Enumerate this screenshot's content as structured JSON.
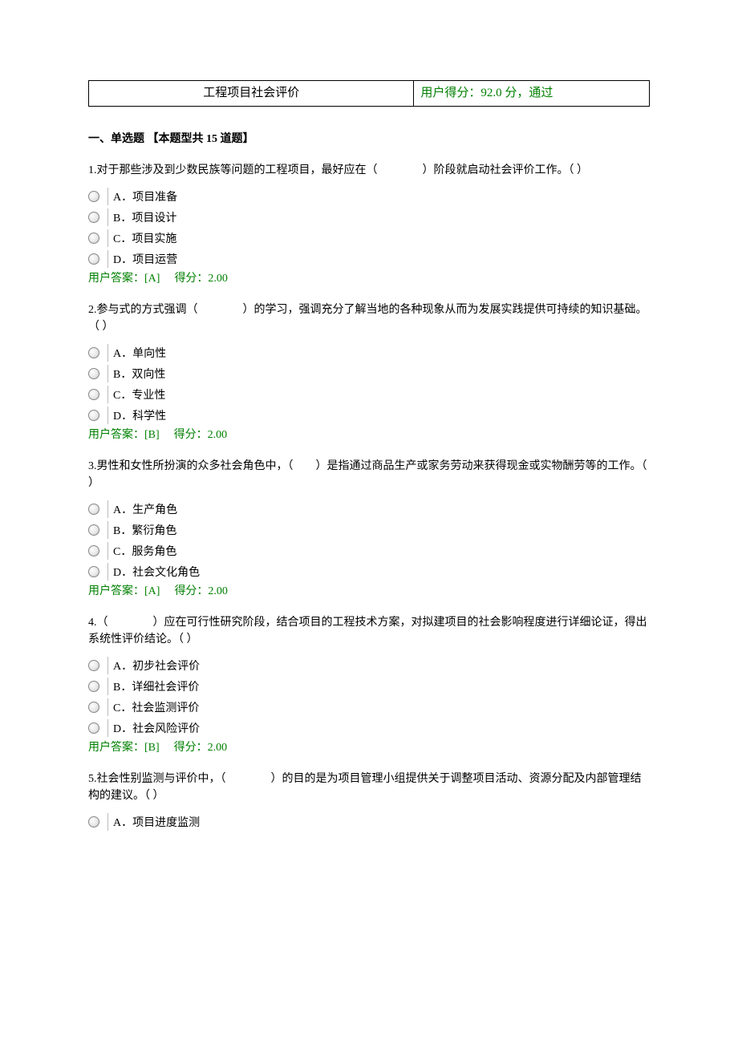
{
  "header": {
    "title": "工程项目社会评价",
    "score": "用户得分：92.0 分，通过"
  },
  "section": {
    "title": "一、单选题 【本题型共 15 道题】"
  },
  "questions": [
    {
      "text": "1.对于那些涉及到少数民族等问题的工程项目，最好应在（　　　　）阶段就启动社会评价工作。（ ）",
      "options": [
        "A．项目准备",
        "B．项目设计",
        "C．项目实施",
        "D．项目运营"
      ],
      "answer": "用户答案：[A]",
      "score": "得分：2.00"
    },
    {
      "text": "2.参与式的方式强调（　　　　）的学习，强调充分了解当地的各种现象从而为发展实践提供可持续的知识基础。（ ）",
      "options": [
        "A．单向性",
        "B．双向性",
        "C．专业性",
        "D．科学性"
      ],
      "answer": "用户答案：[B]",
      "score": "得分：2.00"
    },
    {
      "text": "3.男性和女性所扮演的众多社会角色中，（　　）是指通过商品生产或家务劳动来获得现金或实物酬劳等的工作。（ ）",
      "options": [
        "A．生产角色",
        "B．繁衍角色",
        "C．服务角色",
        "D．社会文化角色"
      ],
      "answer": "用户答案：[A]",
      "score": "得分：2.00"
    },
    {
      "text": "4.（　　　　）应在可行性研究阶段，结合项目的工程技术方案，对拟建项目的社会影响程度进行详细论证，得出系统性评价结论。（ ）",
      "options": [
        "A．初步社会评价",
        "B．详细社会评价",
        "C．社会监测评价",
        "D．社会风险评价"
      ],
      "answer": "用户答案：[B]",
      "score": "得分：2.00"
    },
    {
      "text": "5.社会性别监测与评价中，（　　　　）的目的是为项目管理小组提供关于调整项目活动、资源分配及内部管理结构的建议。（ ）",
      "options": [
        "A．项目进度监测"
      ],
      "answer": "",
      "score": ""
    }
  ]
}
